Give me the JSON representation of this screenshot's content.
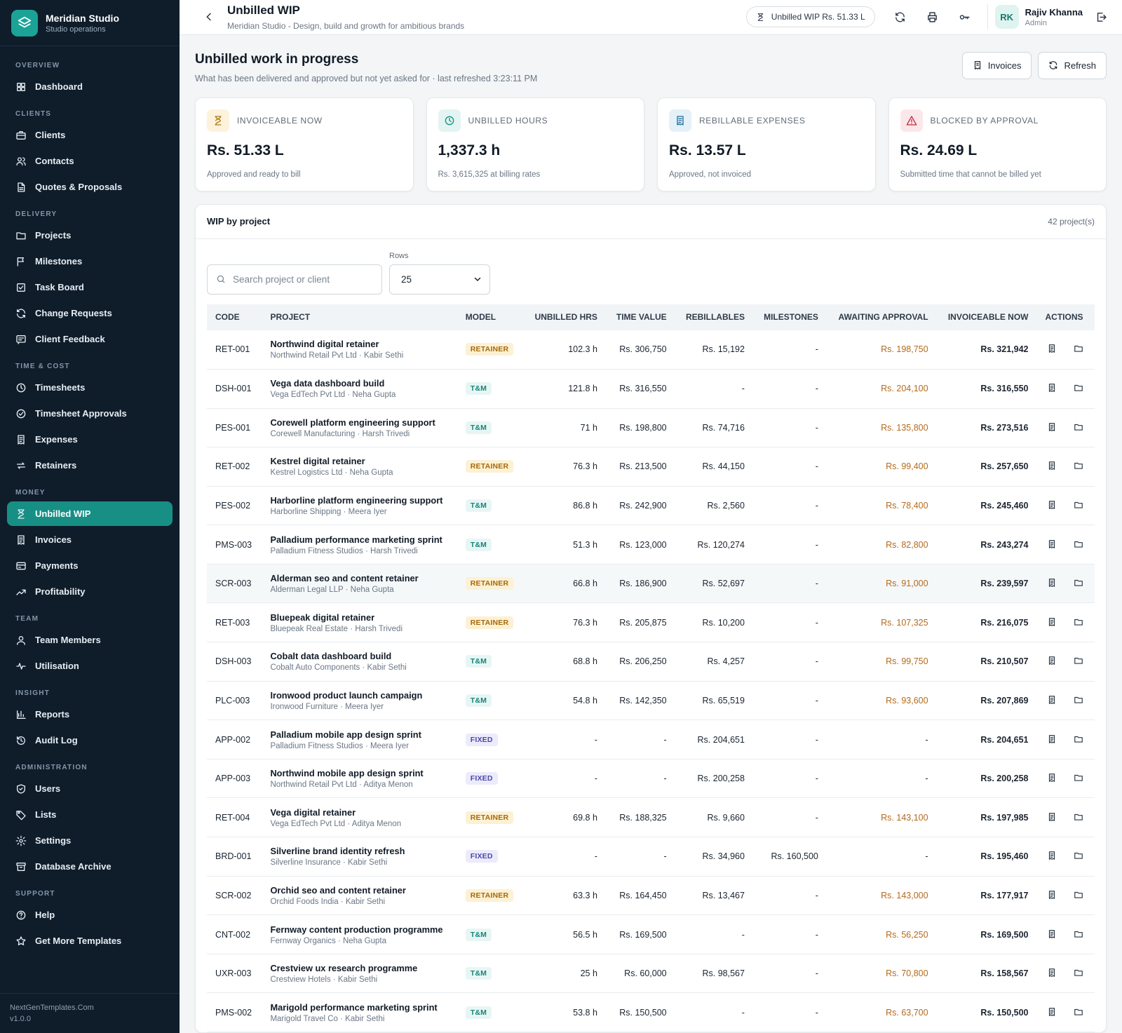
{
  "brand": {
    "name": "Meridian Studio",
    "subtitle": "Studio operations"
  },
  "nav": [
    {
      "section": "OVERVIEW",
      "items": [
        {
          "label": "Dashboard",
          "icon": "grid-icon"
        }
      ]
    },
    {
      "section": "CLIENTS",
      "items": [
        {
          "label": "Clients",
          "icon": "briefcase-icon"
        },
        {
          "label": "Contacts",
          "icon": "users-icon"
        },
        {
          "label": "Quotes & Proposals",
          "icon": "document-icon"
        }
      ]
    },
    {
      "section": "DELIVERY",
      "items": [
        {
          "label": "Projects",
          "icon": "folder-icon"
        },
        {
          "label": "Milestones",
          "icon": "flag-icon"
        },
        {
          "label": "Task Board",
          "icon": "checkbox-icon"
        },
        {
          "label": "Change Requests",
          "icon": "refresh-icon"
        },
        {
          "label": "Client Feedback",
          "icon": "message-icon"
        }
      ]
    },
    {
      "section": "TIME & COST",
      "items": [
        {
          "label": "Timesheets",
          "icon": "clock-icon"
        },
        {
          "label": "Timesheet Approvals",
          "icon": "check-circle-icon"
        },
        {
          "label": "Expenses",
          "icon": "receipt-icon"
        },
        {
          "label": "Retainers",
          "icon": "repeat-icon"
        }
      ]
    },
    {
      "section": "MONEY",
      "items": [
        {
          "label": "Unbilled WIP",
          "icon": "hourglass-icon",
          "active": true
        },
        {
          "label": "Invoices",
          "icon": "receipt-icon"
        },
        {
          "label": "Payments",
          "icon": "card-icon"
        },
        {
          "label": "Profitability",
          "icon": "trend-icon"
        }
      ]
    },
    {
      "section": "TEAM",
      "items": [
        {
          "label": "Team Members",
          "icon": "user-icon"
        },
        {
          "label": "Utilisation",
          "icon": "pulse-icon"
        }
      ]
    },
    {
      "section": "INSIGHT",
      "items": [
        {
          "label": "Reports",
          "icon": "bar-chart-icon"
        },
        {
          "label": "Audit Log",
          "icon": "history-icon"
        }
      ]
    },
    {
      "section": "ADMINISTRATION",
      "items": [
        {
          "label": "Users",
          "icon": "shield-icon"
        },
        {
          "label": "Lists",
          "icon": "tag-icon"
        },
        {
          "label": "Settings",
          "icon": "gear-icon"
        },
        {
          "label": "Database Archive",
          "icon": "archive-icon"
        }
      ]
    },
    {
      "section": "SUPPORT",
      "items": [
        {
          "label": "Help",
          "icon": "help-icon"
        },
        {
          "label": "Get More Templates",
          "icon": "star-icon"
        }
      ]
    }
  ],
  "footer": {
    "site": "NextGenTemplates.Com",
    "version": "v1.0.0"
  },
  "topbar": {
    "title": "Unbilled WIP",
    "subtitle": "Meridian Studio - Design, build and growth for ambitious brands",
    "wip_pill": "Unbilled WIP Rs. 51.33 L",
    "user": {
      "initials": "RK",
      "name": "Rajiv Khanna",
      "role": "Admin"
    }
  },
  "page": {
    "title": "Unbilled work in progress",
    "subtitle": "What has been delivered and approved but not yet asked for · last refreshed 3:23:11 PM",
    "invoices_btn": "Invoices",
    "refresh_btn": "Refresh"
  },
  "kpis": [
    {
      "label": "INVOICEABLE NOW",
      "value": "Rs. 51.33 L",
      "note": "Approved and ready to bill",
      "icon": "hourglass-icon",
      "bg": "#fdf3dc",
      "fg": "#b07a12"
    },
    {
      "label": "UNBILLED HOURS",
      "value": "1,337.3 h",
      "note": "Rs. 3,615,325 at billing rates",
      "icon": "clock-icon",
      "bg": "#e3f4f2",
      "fg": "#178f84"
    },
    {
      "label": "REBILLABLE EXPENSES",
      "value": "Rs. 13.57 L",
      "note": "Approved, not invoiced",
      "icon": "receipt-icon",
      "bg": "#e5f1f8",
      "fg": "#1f6f9e"
    },
    {
      "label": "BLOCKED BY APPROVAL",
      "value": "Rs. 24.69 L",
      "note": "Submitted time that cannot be billed yet",
      "icon": "warning-icon",
      "bg": "#fbe7ea",
      "fg": "#c0303f"
    }
  ],
  "panel": {
    "title": "WIP by project",
    "count": "42 project(s)",
    "search_placeholder": "Search project or client",
    "rows_label": "Rows",
    "rows_value": "25"
  },
  "table": {
    "columns": [
      "CODE",
      "PROJECT",
      "MODEL",
      "UNBILLED HRS",
      "TIME VALUE",
      "REBILLABLES",
      "MILESTONES",
      "AWAITING APPROVAL",
      "INVOICEABLE NOW",
      "ACTIONS"
    ],
    "rows": [
      {
        "code": "RET-001",
        "name": "Northwind digital retainer",
        "client": "Northwind Retail Pvt Ltd · Kabir Sethi",
        "model": "RETAINER",
        "hrs": "102.3 h",
        "time": "Rs. 306,750",
        "rebill": "Rs. 15,192",
        "miles": "-",
        "await": "Rs. 198,750",
        "inv": "Rs. 321,942"
      },
      {
        "code": "DSH-001",
        "name": "Vega data dashboard build",
        "client": "Vega EdTech Pvt Ltd · Neha Gupta",
        "model": "T&M",
        "hrs": "121.8 h",
        "time": "Rs. 316,550",
        "rebill": "-",
        "miles": "-",
        "await": "Rs. 204,100",
        "inv": "Rs. 316,550"
      },
      {
        "code": "PES-001",
        "name": "Corewell platform engineering support",
        "client": "Corewell Manufacturing · Harsh Trivedi",
        "model": "T&M",
        "hrs": "71 h",
        "time": "Rs. 198,800",
        "rebill": "Rs. 74,716",
        "miles": "-",
        "await": "Rs. 135,800",
        "inv": "Rs. 273,516"
      },
      {
        "code": "RET-002",
        "name": "Kestrel digital retainer",
        "client": "Kestrel Logistics Ltd · Neha Gupta",
        "model": "RETAINER",
        "hrs": "76.3 h",
        "time": "Rs. 213,500",
        "rebill": "Rs. 44,150",
        "miles": "-",
        "await": "Rs. 99,400",
        "inv": "Rs. 257,650"
      },
      {
        "code": "PES-002",
        "name": "Harborline platform engineering support",
        "client": "Harborline Shipping · Meera Iyer",
        "model": "T&M",
        "hrs": "86.8 h",
        "time": "Rs. 242,900",
        "rebill": "Rs. 2,560",
        "miles": "-",
        "await": "Rs. 78,400",
        "inv": "Rs. 245,460"
      },
      {
        "code": "PMS-003",
        "name": "Palladium performance marketing sprint",
        "client": "Palladium Fitness Studios · Harsh Trivedi",
        "model": "T&M",
        "hrs": "51.3 h",
        "time": "Rs. 123,000",
        "rebill": "Rs. 120,274",
        "miles": "-",
        "await": "Rs. 82,800",
        "inv": "Rs. 243,274"
      },
      {
        "code": "SCR-003",
        "name": "Alderman seo and content retainer",
        "client": "Alderman Legal LLP · Neha Gupta",
        "model": "RETAINER",
        "hrs": "66.8 h",
        "time": "Rs. 186,900",
        "rebill": "Rs. 52,697",
        "miles": "-",
        "await": "Rs. 91,000",
        "inv": "Rs. 239,597",
        "hl": true
      },
      {
        "code": "RET-003",
        "name": "Bluepeak digital retainer",
        "client": "Bluepeak Real Estate · Harsh Trivedi",
        "model": "RETAINER",
        "hrs": "76.3 h",
        "time": "Rs. 205,875",
        "rebill": "Rs. 10,200",
        "miles": "-",
        "await": "Rs. 107,325",
        "inv": "Rs. 216,075"
      },
      {
        "code": "DSH-003",
        "name": "Cobalt data dashboard build",
        "client": "Cobalt Auto Components · Kabir Sethi",
        "model": "T&M",
        "hrs": "68.8 h",
        "time": "Rs. 206,250",
        "rebill": "Rs. 4,257",
        "miles": "-",
        "await": "Rs. 99,750",
        "inv": "Rs. 210,507"
      },
      {
        "code": "PLC-003",
        "name": "Ironwood product launch campaign",
        "client": "Ironwood Furniture · Meera Iyer",
        "model": "T&M",
        "hrs": "54.8 h",
        "time": "Rs. 142,350",
        "rebill": "Rs. 65,519",
        "miles": "-",
        "await": "Rs. 93,600",
        "inv": "Rs. 207,869"
      },
      {
        "code": "APP-002",
        "name": "Palladium mobile app design sprint",
        "client": "Palladium Fitness Studios · Meera Iyer",
        "model": "FIXED",
        "hrs": "-",
        "time": "-",
        "rebill": "Rs. 204,651",
        "miles": "-",
        "await": "-",
        "inv": "Rs. 204,651"
      },
      {
        "code": "APP-003",
        "name": "Northwind mobile app design sprint",
        "client": "Northwind Retail Pvt Ltd · Aditya Menon",
        "model": "FIXED",
        "hrs": "-",
        "time": "-",
        "rebill": "Rs. 200,258",
        "miles": "-",
        "await": "-",
        "inv": "Rs. 200,258"
      },
      {
        "code": "RET-004",
        "name": "Vega digital retainer",
        "client": "Vega EdTech Pvt Ltd · Aditya Menon",
        "model": "RETAINER",
        "hrs": "69.8 h",
        "time": "Rs. 188,325",
        "rebill": "Rs. 9,660",
        "miles": "-",
        "await": "Rs. 143,100",
        "inv": "Rs. 197,985"
      },
      {
        "code": "BRD-001",
        "name": "Silverline brand identity refresh",
        "client": "Silverline Insurance · Kabir Sethi",
        "model": "FIXED",
        "hrs": "-",
        "time": "-",
        "rebill": "Rs. 34,960",
        "miles": "Rs. 160,500",
        "await": "-",
        "inv": "Rs. 195,460"
      },
      {
        "code": "SCR-002",
        "name": "Orchid seo and content retainer",
        "client": "Orchid Foods India · Kabir Sethi",
        "model": "RETAINER",
        "hrs": "63.3 h",
        "time": "Rs. 164,450",
        "rebill": "Rs. 13,467",
        "miles": "-",
        "await": "Rs. 143,000",
        "inv": "Rs. 177,917"
      },
      {
        "code": "CNT-002",
        "name": "Fernway content production programme",
        "client": "Fernway Organics · Neha Gupta",
        "model": "T&M",
        "hrs": "56.5 h",
        "time": "Rs. 169,500",
        "rebill": "-",
        "miles": "-",
        "await": "Rs. 56,250",
        "inv": "Rs. 169,500"
      },
      {
        "code": "UXR-003",
        "name": "Crestview ux research programme",
        "client": "Crestview Hotels · Kabir Sethi",
        "model": "T&M",
        "hrs": "25 h",
        "time": "Rs. 60,000",
        "rebill": "Rs. 98,567",
        "miles": "-",
        "await": "Rs. 70,800",
        "inv": "Rs. 158,567"
      },
      {
        "code": "PMS-002",
        "name": "Marigold performance marketing sprint",
        "client": "Marigold Travel Co · Kabir Sethi",
        "model": "T&M",
        "hrs": "53.8 h",
        "time": "Rs. 150,500",
        "rebill": "-",
        "miles": "-",
        "await": "Rs. 63,700",
        "inv": "Rs. 150,500"
      }
    ]
  }
}
